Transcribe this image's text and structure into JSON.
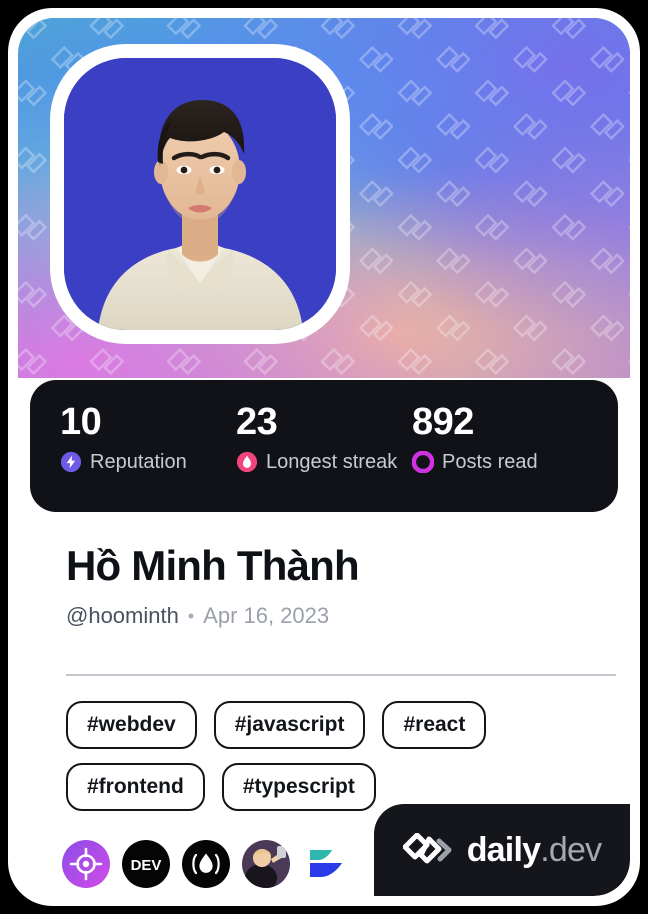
{
  "card": {
    "background_color": "#ffffff",
    "border_color": "#ffffff",
    "outer_background": "#000000"
  },
  "cover": {
    "pattern_icon": "daily-dev-logo-watermark",
    "gradient_colors": [
      "#4fa3d8",
      "#4f8fe8",
      "#5f86e6",
      "#9a86df",
      "#b58ad4",
      "#e278e2",
      "#f7be96",
      "#8cd8cd"
    ]
  },
  "avatar": {
    "alt": "Hồ Minh Thành profile photo",
    "background_color": "#3b3fc4",
    "frame_color": "#ffffff"
  },
  "stats": {
    "background_color": "#111217",
    "items": [
      {
        "value": "10",
        "label": "Reputation",
        "icon": "reputation-bolt-icon",
        "icon_color": "#6e5ae6"
      },
      {
        "value": "23",
        "label": "Longest streak",
        "icon": "streak-flame-icon",
        "icon_color": "#f4447d"
      },
      {
        "value": "892",
        "label": "Posts read",
        "icon": "posts-read-ring-icon",
        "icon_color": "#cf31e3"
      }
    ]
  },
  "profile": {
    "display_name": "Hồ Minh Thành",
    "handle": "@hoominth",
    "separator": "•",
    "joined": "Apr 16, 2023"
  },
  "tags": [
    {
      "label": "#webdev"
    },
    {
      "label": "#javascript"
    },
    {
      "label": "#react"
    },
    {
      "label": "#frontend"
    },
    {
      "label": "#typescript"
    }
  ],
  "socials": [
    {
      "name": "roadmap-target-icon",
      "title": "roadmap.sh"
    },
    {
      "name": "dev-to-icon",
      "title": "DEV",
      "text": "DEV"
    },
    {
      "name": "hashnode-flame-icon",
      "title": "Hashnode"
    },
    {
      "name": "portfolio-avatar-icon",
      "title": "Portfolio"
    },
    {
      "name": "arrows-logo-icon",
      "title": "Link"
    }
  ],
  "brand": {
    "mark": "daily-dev-logo",
    "name_primary": "daily",
    "name_secondary": ".dev",
    "background_color": "#14161b"
  }
}
